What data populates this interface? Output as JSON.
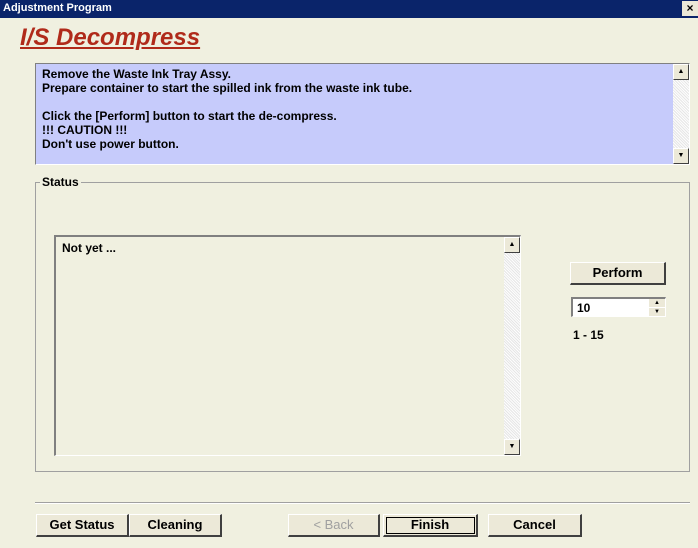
{
  "window": {
    "title": "Adjustment Program",
    "close_glyph": "×"
  },
  "page": {
    "heading": "I/S Decompress"
  },
  "instructions": {
    "lines": [
      "Remove the Waste Ink Tray Assy.",
      "Prepare container to start the spilled ink from the waste ink tube.",
      "",
      "Click the [Perform] button to start the de-compress.",
      "!!! CAUTION !!!",
      "Don't use power button."
    ]
  },
  "status": {
    "label": "Status",
    "text": "Not yet ..."
  },
  "perform": {
    "button_label": "Perform",
    "spinner_value": "10",
    "range": "1 - 15"
  },
  "footer": {
    "get_status": "Get Status",
    "cleaning": "Cleaning",
    "back": "< Back",
    "finish": "Finish",
    "cancel": "Cancel"
  },
  "icons": {
    "scroll_up": "scroll-up-arrow-icon",
    "scroll_down": "scroll-down-arrow-icon",
    "spin_up": "spin-up-arrow-icon",
    "spin_down": "spin-down-arrow-icon",
    "close": "close-icon"
  }
}
